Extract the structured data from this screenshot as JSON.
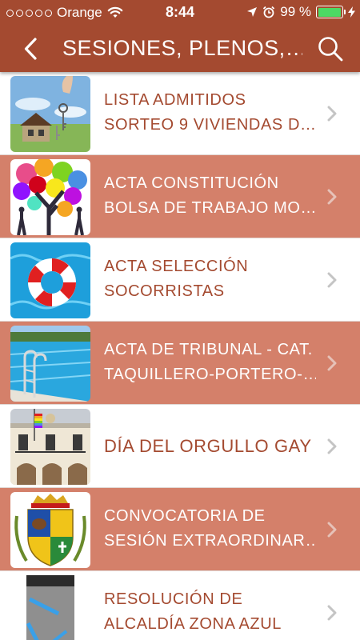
{
  "status_bar": {
    "carrier": "Orange",
    "time": "8:44",
    "battery": "99 %",
    "battery_level": 0.99,
    "signal_bars": 5,
    "signal_filled": 0
  },
  "nav": {
    "title": "SESIONES, PLENOS,…",
    "back_icon": "chevron-left-icon",
    "search_icon": "search-icon"
  },
  "colors": {
    "header": "#a44a30",
    "row_alt": "#d4806a",
    "text_primary": "#a44a30",
    "text_on_alt": "#ffffff"
  },
  "items": [
    {
      "line1": "LISTA ADMITIDOS",
      "line2": "SORTEO 9 VIVIENDAS D…"
    },
    {
      "line1": "ACTA CONSTITUCIÓN",
      "line2": "BOLSA DE TRABAJO MO…"
    },
    {
      "line1": "ACTA SELECCIÓN",
      "line2": "SOCORRISTAS"
    },
    {
      "line1": "ACTA DE TRIBUNAL - CAT.",
      "line2": "TAQUILLERO-PORTERO-…"
    },
    {
      "line1": "DÍA DEL ORGULLO GAY"
    },
    {
      "line1": "CONVOCATORIA DE",
      "line2": "SESIÓN EXTRAORDINAR…"
    },
    {
      "line1": "RESOLUCIÓN DE",
      "line2": "ALCALDÍA ZONA AZUL"
    }
  ]
}
